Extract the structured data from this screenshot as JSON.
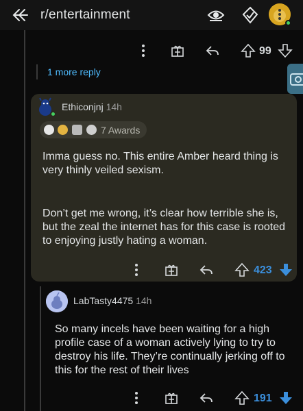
{
  "header": {
    "title": "r/entertainment"
  },
  "top_actions": {
    "score": "99"
  },
  "more_replies": "1 more reply",
  "comment1": {
    "username": "Ethiconjnj",
    "time": "14h",
    "awards_label": "7 Awards",
    "paragraph1": "Imma guess no.  This entire Amber heard thing is very thinly veiled sexism.",
    "paragraph2": "Don’t get me wrong, it’s clear how terrible she is, but the zeal the internet has for this case is rooted to enjoying justly hating a woman.",
    "score": "423"
  },
  "comment2": {
    "username": "LabTasty4475",
    "time": "14h",
    "text": "So many incels have been waiting for a high profile case of a woman actively lying to try to destroy his life. They’re continually jerking off to this for the rest of their lives",
    "score": "191"
  },
  "colors": {
    "accent_blue": "#4fbcff",
    "upvoted_blue": "#3b8fdc",
    "highlight_bg": "#2b2a21",
    "online_green": "#46d160"
  }
}
